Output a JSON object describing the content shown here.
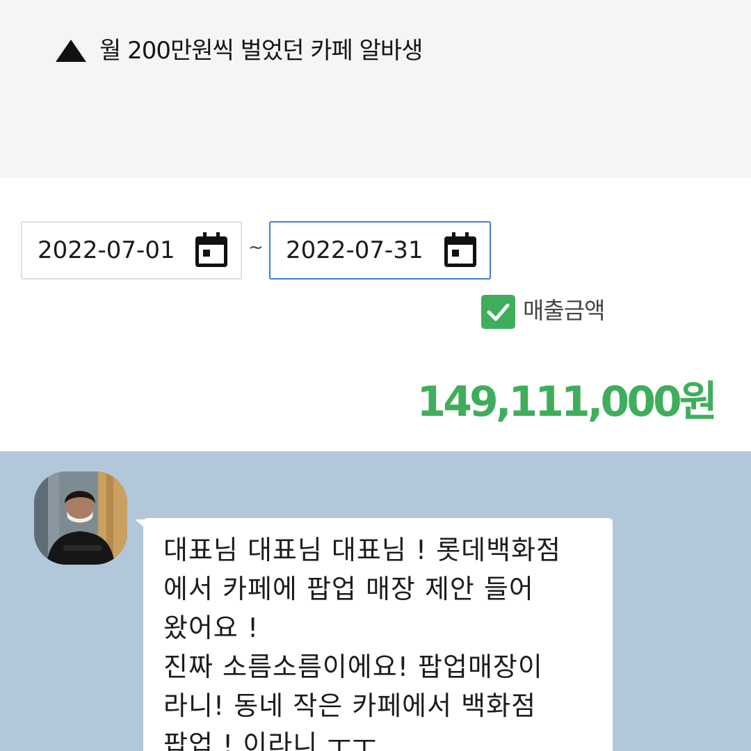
{
  "caption": {
    "icon": "triangle-up-icon",
    "text": "월 200만원씩 벌었던 카페 알바생"
  },
  "date_range": {
    "start": "2022-07-01",
    "separator": "~",
    "end": "2022-07-31",
    "icon": "calendar-icon",
    "active_color": "#3b7fd1"
  },
  "sales_checkbox": {
    "checked": true,
    "label": "매출금액"
  },
  "total": {
    "amount": "149,111,000원",
    "color": "#3fae5c"
  },
  "chat": {
    "background": "#b2c7da",
    "message_lines": [
      "대표님 대표님 대표님 ! 롯데백화점",
      "에서 카페에 팝업 매장 제안 들어",
      "왔어요 !",
      "진짜 소름소름이에요! 팝업매장이",
      "라니! 동네 작은 카페에서 백화점",
      "팝업 ! 이라니 ㅜㅜ"
    ]
  }
}
